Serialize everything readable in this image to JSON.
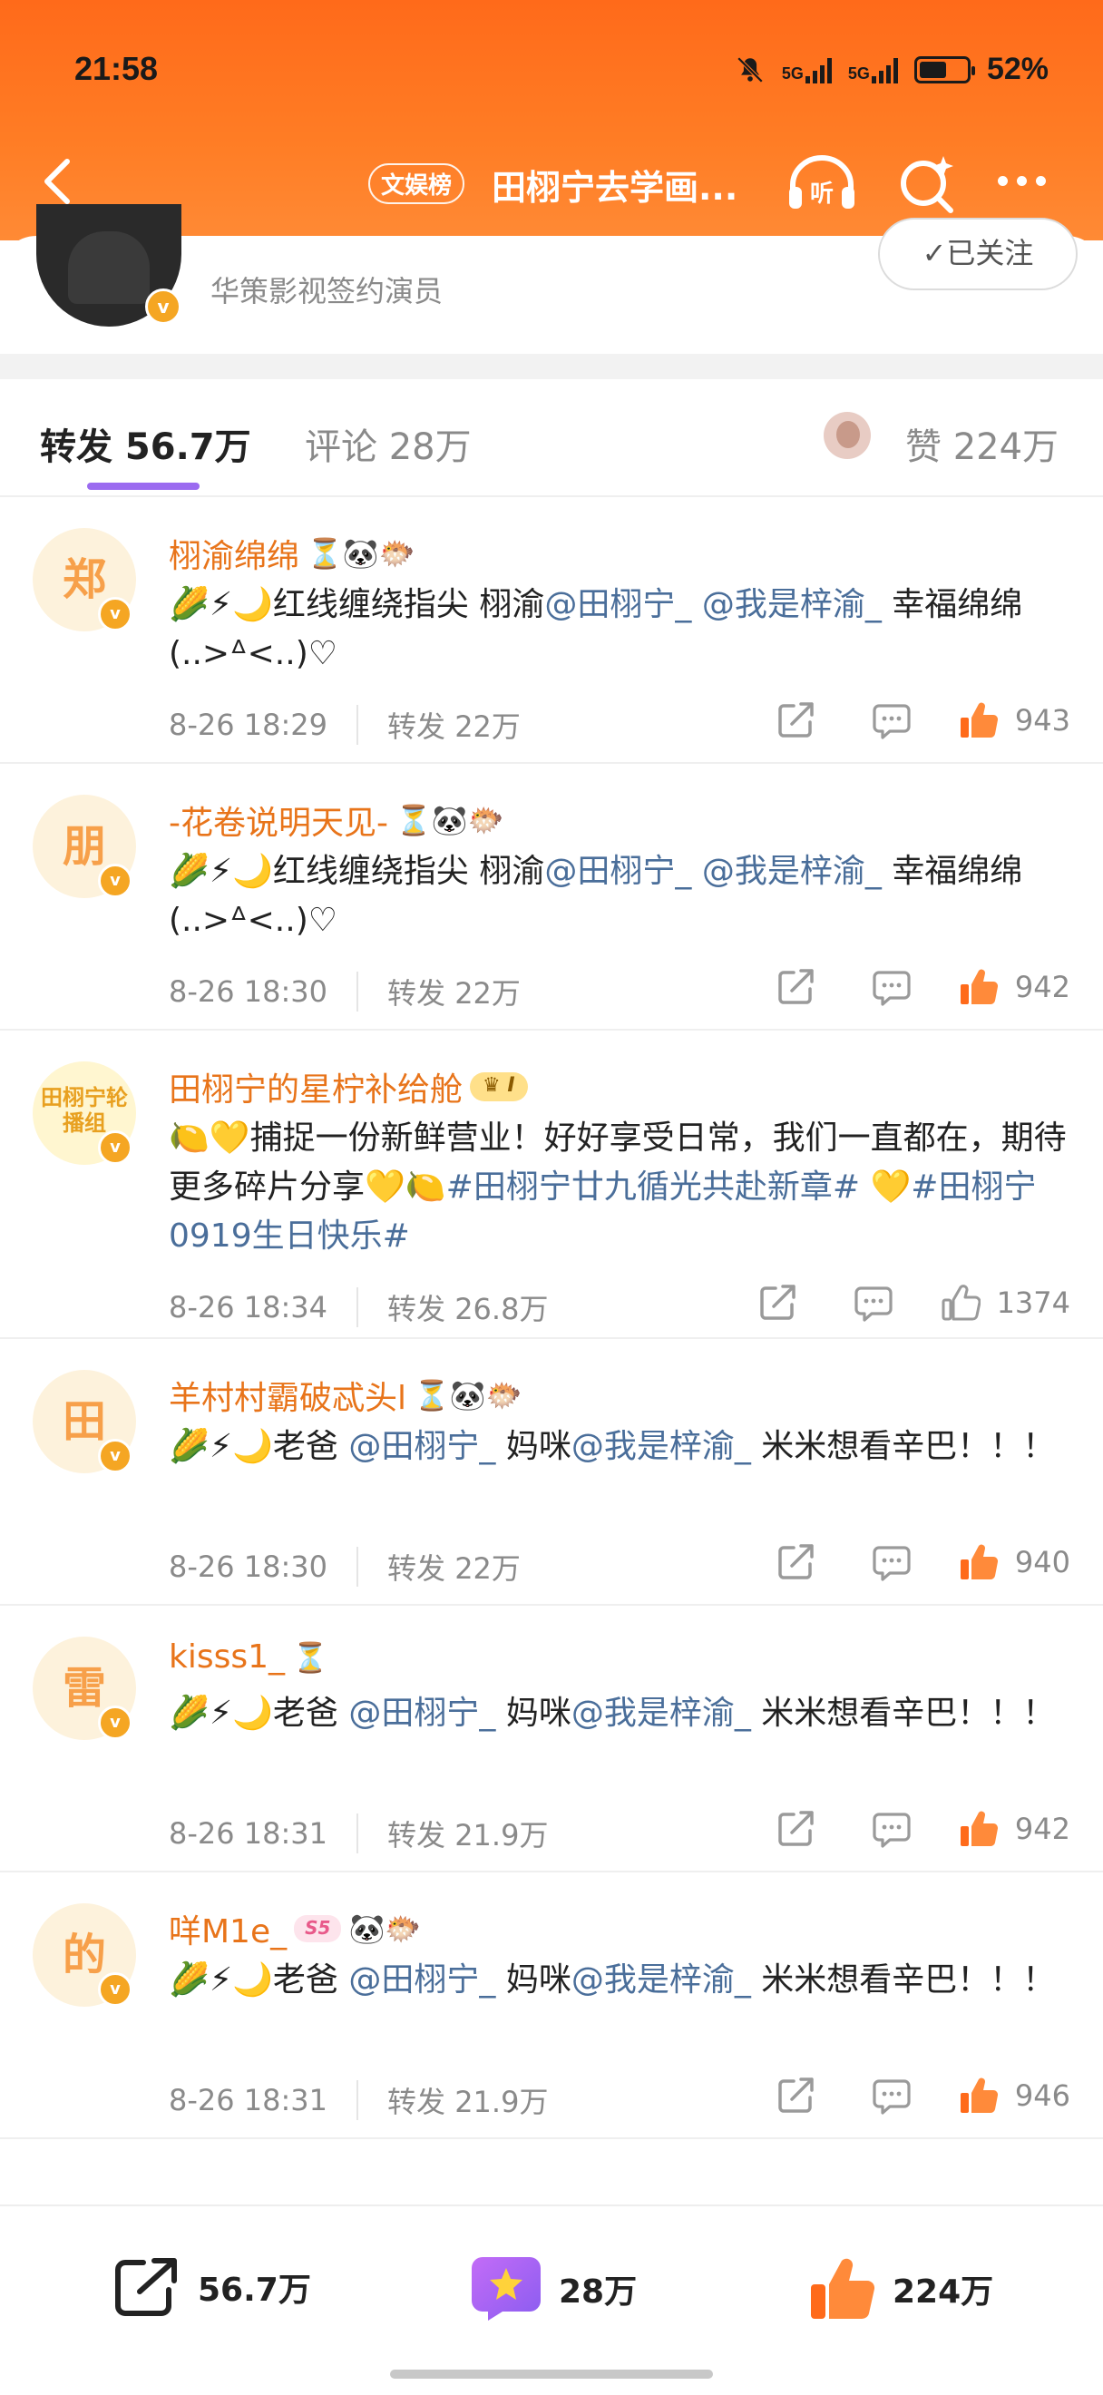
{
  "status_bar": {
    "time": "21:58",
    "network_1": "5G",
    "network_2": "5G",
    "battery": "52%"
  },
  "nav": {
    "badge": "文娱榜",
    "title": "田栩宁去学画...",
    "listen_label": "听",
    "icons": [
      "back-icon",
      "headphones-icon",
      "search-sparkle-icon",
      "more-icon"
    ]
  },
  "author": {
    "description": "华策影视签约演员",
    "follow_label": "✓已关注"
  },
  "tabs": {
    "repost": "转发 56.7万",
    "comment": "评论 28万",
    "like": "赞 224万"
  },
  "repost_label": "转发",
  "posts": [
    {
      "avatar_char": "郑",
      "username": "栩渝绵绵",
      "emojis": "⏳🐼🐡",
      "text_prefix": "🌽⚡🌙红线缠绕指尖 栩渝",
      "mention_1": "@田栩宁_",
      "mid": " ",
      "mention_2": "@我是梓渝_",
      "text_suffix": " 幸福绵绵(..>ᐞ<..)♡",
      "time": "8-26 18:29",
      "reposts": "转发 22万",
      "likes": "943",
      "liked": true
    },
    {
      "avatar_char": "朋",
      "username": "-花卷说明天见-",
      "emojis": "⏳🐼🐡",
      "text_prefix": "🌽⚡🌙红线缠绕指尖 栩渝",
      "mention_1": "@田栩宁_",
      "mid": " ",
      "mention_2": "@我是梓渝_",
      "text_suffix": " 幸福绵绵(..>ᐞ<..)♡",
      "time": "8-26 18:30",
      "reposts": "转发 22万",
      "likes": "942",
      "liked": true
    },
    {
      "avatar_char": "田栩宁轮播组",
      "username": "田栩宁的星柠补给舱",
      "level": "♛ I",
      "text_prefix": "🍋💛捕捉一份新鲜营业！好好享受日常，我们一直都在，期待更多碎片分享💛🍋",
      "mention_1": "#田栩宁廿九循光共赴新章#",
      "mid": " 💛",
      "mention_2": "#田栩宁0919生日快乐#",
      "text_suffix": "",
      "time": "8-26 18:34",
      "reposts": "转发 26.8万",
      "likes": "1374",
      "liked": false
    },
    {
      "avatar_char": "田",
      "username": "羊村村霸破忒头l",
      "emojis": "⏳🐼🐡",
      "text_prefix": "🌽⚡🌙老爸 ",
      "mention_1": "@田栩宁_",
      "mid": " 妈咪",
      "mention_2": "@我是梓渝_",
      "text_suffix": " 米米想看辛巴！！！",
      "time": "8-26 18:30",
      "reposts": "转发 22万",
      "likes": "940",
      "liked": true
    },
    {
      "avatar_char": "雷",
      "username": "kisss1_",
      "emojis": "⏳",
      "text_prefix": "🌽⚡🌙老爸 ",
      "mention_1": "@田栩宁_",
      "mid": " 妈咪",
      "mention_2": "@我是梓渝_",
      "text_suffix": " 米米想看辛巴！！！",
      "time": "8-26 18:31",
      "reposts": "转发 21.9万",
      "likes": "942",
      "liked": true
    },
    {
      "avatar_char": "的",
      "username": "咩M1e_",
      "level2": "S5",
      "emojis": "🐼🐡",
      "text_prefix": "🌽⚡🌙老爸 ",
      "mention_1": "@田栩宁_",
      "mid": " 妈咪",
      "mention_2": "@我是梓渝_",
      "text_suffix": " 米米想看辛巴！！！",
      "time": "8-26 18:31",
      "reposts": "转发 21.9万",
      "likes": "946",
      "liked": true
    }
  ],
  "bottom_bar": {
    "repost": "56.7万",
    "comment": "28万",
    "like": "224万"
  },
  "colors": {
    "brand_orange": "#ff6a1a",
    "username": "#e8741a",
    "mention": "#4a6e9a",
    "tab_underline": "#9b6bf0"
  }
}
